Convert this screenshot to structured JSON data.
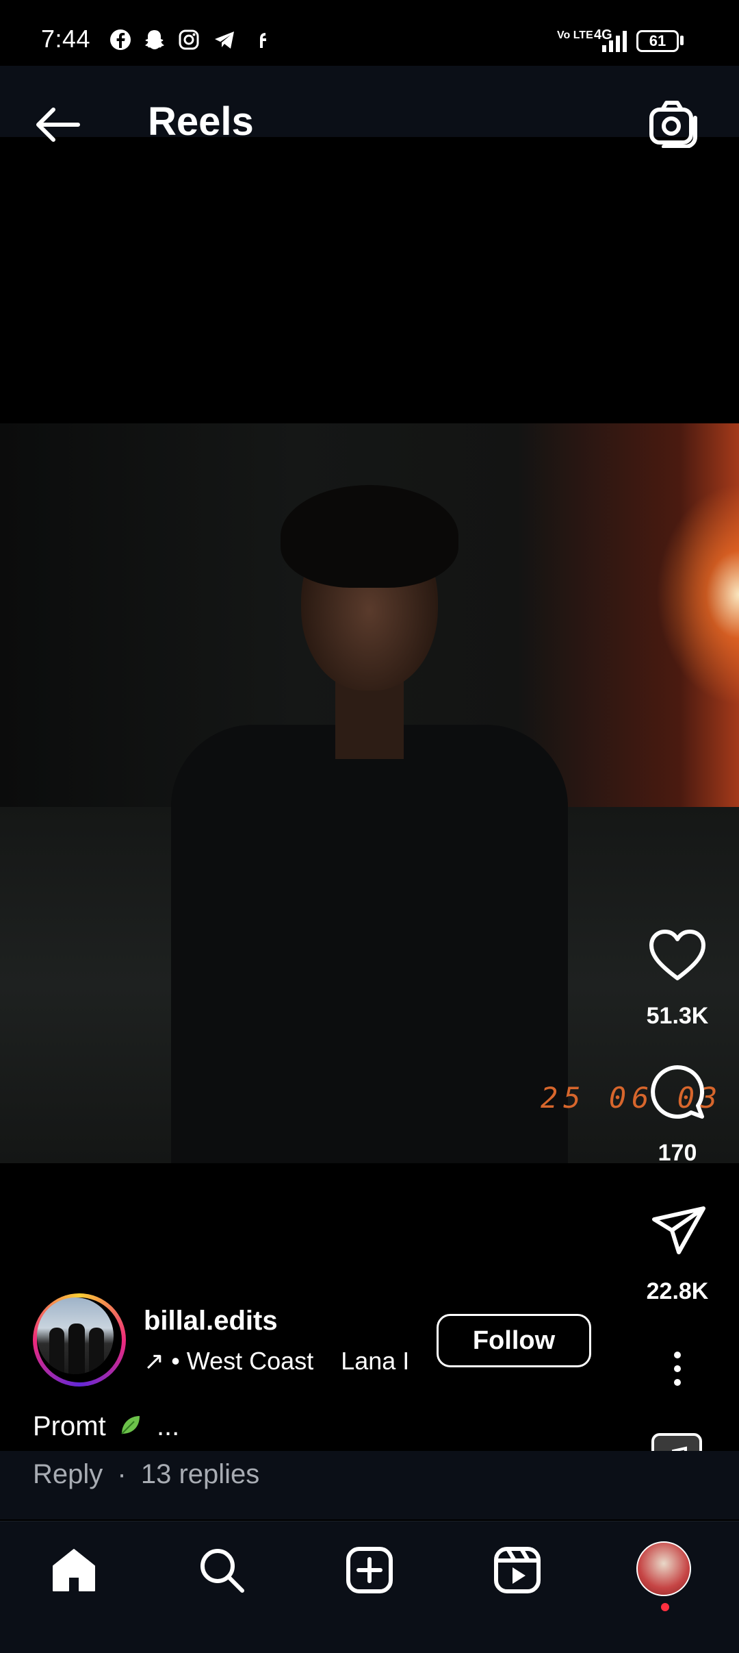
{
  "status_bar": {
    "time": "7:44",
    "network": "4G",
    "volte": "Vo LTE",
    "battery": "61"
  },
  "header": {
    "title": "Reels"
  },
  "video": {
    "timestamp": "25 06 03"
  },
  "actions": {
    "likes": "51.3K",
    "comments": "170",
    "shares": "22.8K"
  },
  "author": {
    "username": "billal.edits",
    "music_prefix": "↗",
    "music_text": "• West Coast",
    "music_artist": "Lana I",
    "follow_label": "Follow"
  },
  "caption": {
    "text": "Promt",
    "more": "...",
    "reply_label": "Reply",
    "replies": "13 replies"
  },
  "colors": {
    "header_bg": "#0b0f17",
    "notification_dot": "#ff3040",
    "stamp": "#d7662c"
  }
}
